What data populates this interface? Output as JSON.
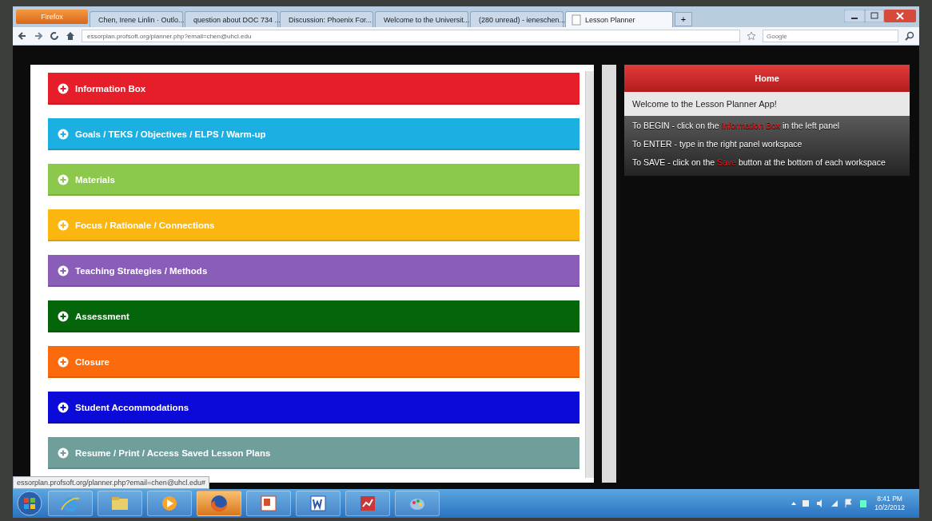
{
  "browser": {
    "menu_button": "Firefox",
    "tabs": [
      {
        "title": "Chen, Irene Linlin · Outlo...",
        "kind": "outlook",
        "selected": false
      },
      {
        "title": "question about DOC 734 ...",
        "kind": "gmail",
        "selected": false
      },
      {
        "title": "Discussion: Phoenix For...",
        "kind": "discussion",
        "selected": false
      },
      {
        "title": "Welcome to the Universit...",
        "kind": "uni",
        "selected": false
      },
      {
        "title": "(280 unread) - ieneschen...",
        "kind": "mail",
        "selected": false
      },
      {
        "title": "Lesson Planner",
        "kind": "page",
        "selected": true
      }
    ],
    "new_tab": "+",
    "address": "essorplan.profsoft.org/planner.php?email=chen@uhcl.edu",
    "search_placeholder": "Google",
    "status_url": "essorplan.profsoft.org/planner.php?email=chen@uhcl.edu#"
  },
  "sections": [
    {
      "label": "Information Box",
      "color": "#e61e2a"
    },
    {
      "label": "Goals / TEKS / Objectives / ELPS / Warm-up",
      "color": "#1cb0e2"
    },
    {
      "label": "Materials",
      "color": "#8cc84b"
    },
    {
      "label": "Focus / Rationale / Connections",
      "color": "#fbb710"
    },
    {
      "label": "Teaching Strategies / Methods",
      "color": "#8a5db9"
    },
    {
      "label": "Assessment",
      "color": "#04650a"
    },
    {
      "label": "Closure",
      "color": "#fb6a0c"
    },
    {
      "label": "Student Accommodations",
      "color": "#0b0ad8"
    },
    {
      "label": "Resume / Print / Access Saved Lesson Plans",
      "color": "#6f9e9b"
    }
  ],
  "home": {
    "title": "Home",
    "welcome": "Welcome to the Lesson Planner App!",
    "instructions": [
      "To BEGIN - click on the **Information Box** in the left panel",
      "To ENTER - type in the right panel workspace",
      "To SAVE - click on the **Save** button at the bottom of each workspace"
    ]
  },
  "taskbar": {
    "apps": [
      {
        "kind": "ie",
        "selected": false
      },
      {
        "kind": "folder",
        "selected": false
      },
      {
        "kind": "media",
        "selected": false
      },
      {
        "kind": "firefox",
        "selected": true
      },
      {
        "kind": "powerpoint",
        "selected": false
      },
      {
        "kind": "word",
        "selected": false
      },
      {
        "kind": "chart",
        "selected": false
      },
      {
        "kind": "paint",
        "selected": false
      }
    ],
    "time": "8:41 PM",
    "date": "10/2/2012"
  }
}
